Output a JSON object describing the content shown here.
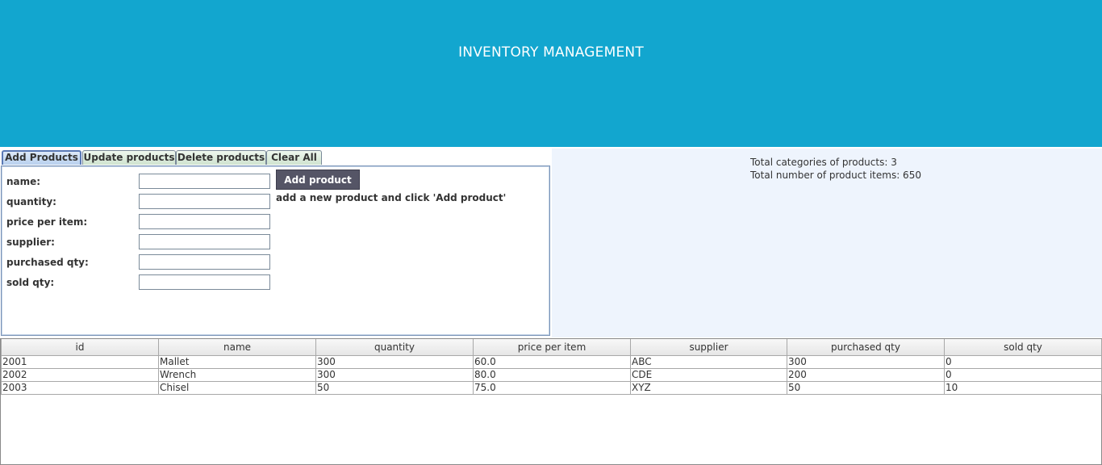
{
  "header": {
    "title": "INVENTORY MANAGEMENT",
    "bg_color": "#12a6cf"
  },
  "tabs": [
    {
      "label": "Add Products",
      "active": true
    },
    {
      "label": "Update products",
      "active": false
    },
    {
      "label": "Delete products",
      "active": false
    },
    {
      "label": "Clear All",
      "active": false
    }
  ],
  "form": {
    "fields": [
      {
        "label": "name:",
        "value": ""
      },
      {
        "label": "quantity:",
        "value": ""
      },
      {
        "label": "price per item:",
        "value": ""
      },
      {
        "label": "supplier:",
        "value": ""
      },
      {
        "label": "purchased qty:",
        "value": ""
      },
      {
        "label": "sold qty:",
        "value": ""
      }
    ],
    "submit_label": "Add product",
    "hint": "add a new product and click 'Add product'"
  },
  "stats": {
    "categories": "Total categories of products: 3",
    "items": "Total number of product items: 650"
  },
  "table": {
    "columns": [
      "id",
      "name",
      "quantity",
      "price per item",
      "supplier",
      "purchased qty",
      "sold qty"
    ],
    "rows": [
      [
        "2001",
        "Mallet",
        "300",
        "60.0",
        "ABC",
        "300",
        "0"
      ],
      [
        "2002",
        "Wrench",
        "300",
        "80.0",
        "CDE",
        "200",
        "0"
      ],
      [
        "2003",
        "Chisel",
        "50",
        "75.0",
        "XYZ",
        "50",
        "10"
      ]
    ]
  }
}
